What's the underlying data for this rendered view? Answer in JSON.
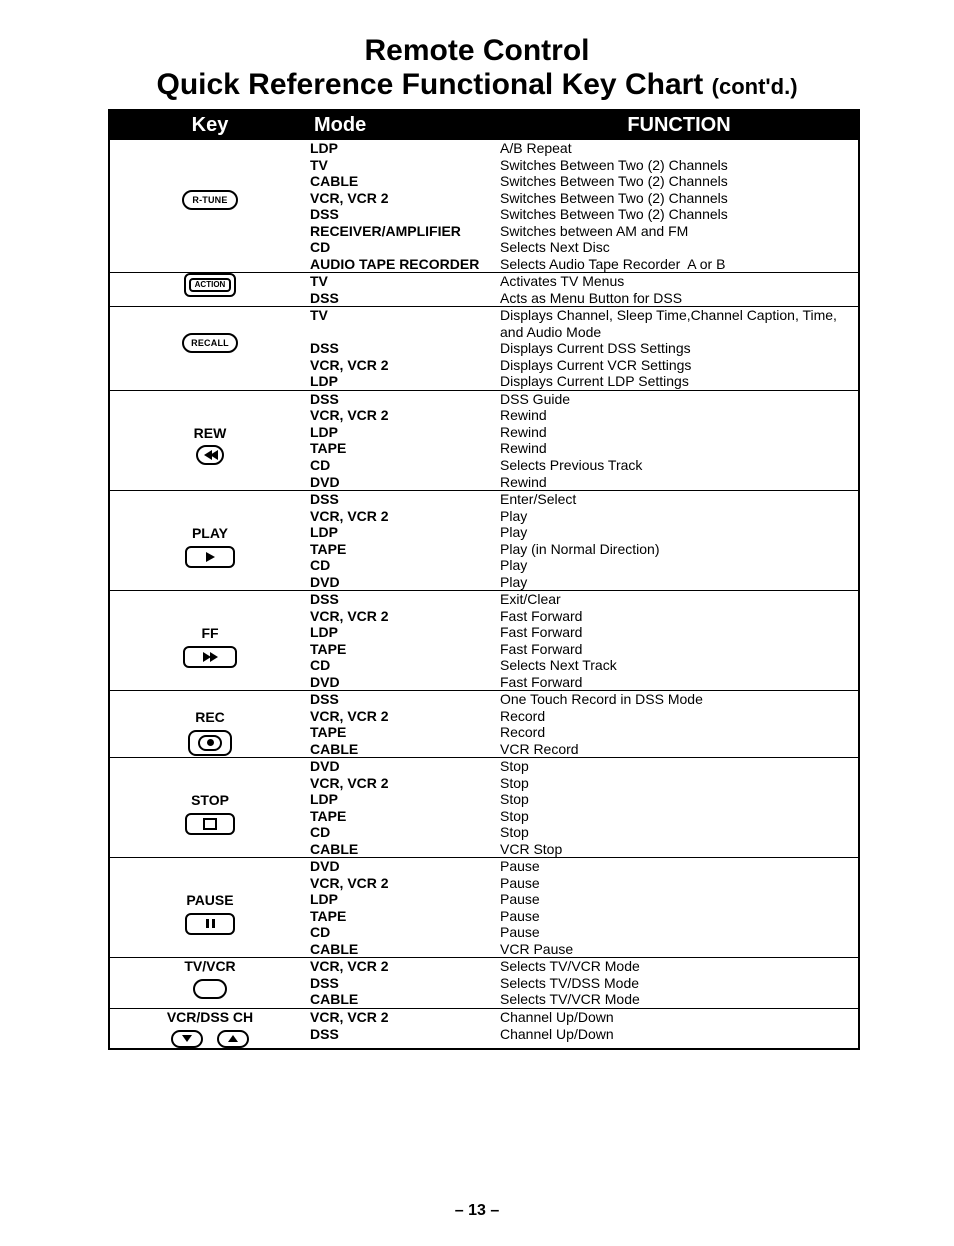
{
  "title_line1": "Remote Control",
  "title_line2_main": "Quick Reference Functional Key Chart",
  "title_line2_cont": "(cont'd.)",
  "header": {
    "key": "Key",
    "mode": "Mode",
    "function": "FUNCTION"
  },
  "page_number": "– 13 –",
  "rows": [
    {
      "keyLabel": "",
      "keyIcon": "rtune",
      "iconText": "R-TUNE",
      "modes": [
        "LDP",
        "TV",
        "CABLE",
        "VCR, VCR 2",
        "DSS",
        "RECEIVER/AMPLIFIER",
        "CD",
        "AUDIO TAPE RECORDER"
      ],
      "funcs": [
        "A/B Repeat",
        "Switches Between Two (2) Channels",
        "Switches Between Two (2) Channels",
        "Switches Between Two (2) Channels",
        "Switches Between Two (2) Channels",
        "Switches between AM and FM",
        "Selects Next Disc",
        "Selects Audio Tape Recorder  A or B"
      ]
    },
    {
      "keyLabel": "",
      "keyIcon": "action",
      "iconText": "ACTION",
      "modes": [
        "TV",
        "DSS"
      ],
      "funcs": [
        "Activates TV Menus",
        "Acts as Menu Button for DSS"
      ]
    },
    {
      "keyLabel": "",
      "keyIcon": "recall",
      "iconText": "RECALL",
      "modes": [
        "TV",
        "",
        "DSS",
        "VCR, VCR 2",
        "LDP"
      ],
      "funcs": [
        "Displays Channel, Sleep Time,Channel Caption, Time,",
        "and Audio Mode",
        "Displays Current DSS Settings",
        "Displays Current VCR Settings",
        "Displays Current LDP Settings"
      ]
    },
    {
      "keyLabel": "REW",
      "keyIcon": "rew",
      "modes": [
        "DSS",
        "VCR, VCR 2",
        "LDP",
        "TAPE",
        "CD",
        "DVD"
      ],
      "funcs": [
        "DSS Guide",
        "Rewind",
        "Rewind",
        "Rewind",
        "Selects Previous Track",
        "Rewind"
      ]
    },
    {
      "keyLabel": "PLAY",
      "keyIcon": "play",
      "modes": [
        "DSS",
        "VCR, VCR 2",
        "LDP",
        "TAPE",
        "CD",
        "DVD"
      ],
      "funcs": [
        "Enter/Select",
        "Play",
        "Play",
        "Play (in Normal Direction)",
        "Play",
        "Play"
      ]
    },
    {
      "keyLabel": "FF",
      "keyIcon": "ff",
      "modes": [
        "DSS",
        "VCR, VCR 2",
        "LDP",
        "TAPE",
        "CD",
        "DVD"
      ],
      "funcs": [
        "Exit/Clear",
        "Fast Forward",
        "Fast Forward",
        "Fast Forward",
        "Selects Next Track",
        "Fast Forward"
      ]
    },
    {
      "keyLabel": "REC",
      "keyIcon": "rec",
      "modes": [
        "DSS",
        "VCR, VCR 2",
        "TAPE",
        "CABLE"
      ],
      "funcs": [
        "One Touch Record in DSS Mode",
        "Record",
        "Record",
        "VCR Record"
      ]
    },
    {
      "keyLabel": "STOP",
      "keyIcon": "stop",
      "modes": [
        "DVD",
        "VCR, VCR 2",
        "LDP",
        "TAPE",
        "CD",
        "CABLE"
      ],
      "funcs": [
        "Stop",
        "Stop",
        "Stop",
        "Stop",
        "Stop",
        "VCR Stop"
      ]
    },
    {
      "keyLabel": "PAUSE",
      "keyIcon": "pause",
      "modes": [
        "DVD",
        "VCR, VCR 2",
        "LDP",
        "TAPE",
        "CD",
        "CABLE"
      ],
      "funcs": [
        "Pause",
        "Pause",
        "Pause",
        "Pause",
        "Pause",
        "VCR Pause"
      ]
    },
    {
      "keyLabel": "TV/VCR",
      "keyIcon": "oval",
      "modes": [
        "VCR, VCR 2",
        "DSS",
        "CABLE"
      ],
      "funcs": [
        "Selects TV/VCR Mode",
        "Selects TV/DSS Mode",
        "Selects TV/VCR Mode"
      ]
    },
    {
      "keyLabel": "VCR/DSS CH",
      "keyIcon": "updown",
      "modes": [
        "VCR, VCR 2",
        "DSS"
      ],
      "funcs": [
        "Channel Up/Down",
        "Channel Up/Down"
      ]
    }
  ]
}
